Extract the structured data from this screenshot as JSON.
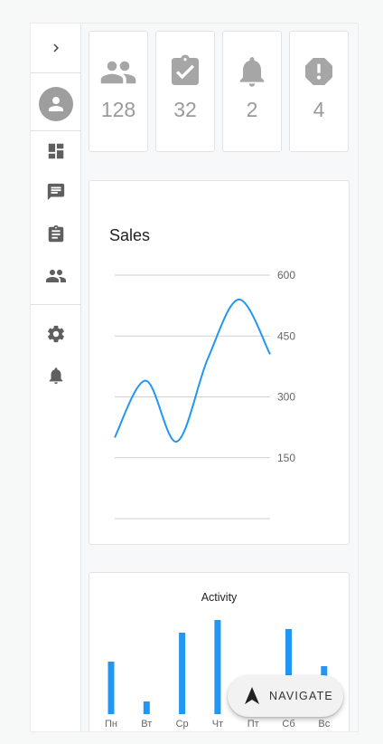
{
  "sidebar": {
    "expand_icon": "chevron-right-icon",
    "items": [
      {
        "name": "dashboard",
        "icon": "dashboard-icon"
      },
      {
        "name": "messages",
        "icon": "message-icon"
      },
      {
        "name": "tasks",
        "icon": "clipboard-icon"
      },
      {
        "name": "users",
        "icon": "people-icon"
      },
      {
        "name": "settings",
        "icon": "gear-icon"
      },
      {
        "name": "notifications",
        "icon": "bell-icon"
      }
    ]
  },
  "stats": [
    {
      "icon": "people-icon",
      "value": "128"
    },
    {
      "icon": "task-done-icon",
      "value": "32"
    },
    {
      "icon": "bell-icon",
      "value": "2"
    },
    {
      "icon": "alert-icon",
      "value": "4"
    }
  ],
  "sales": {
    "title": "Sales"
  },
  "activity": {
    "title": "Activity"
  },
  "fab": {
    "label": "NAVIGATE",
    "icon": "navigation-arrow-icon"
  },
  "colors": {
    "accent": "#2196f3",
    "icon_grey": "#a6a6a6",
    "sidebar_icon": "#5f5f5f"
  },
  "chart_data": [
    {
      "type": "line",
      "title": "Sales",
      "x": [
        1,
        2,
        3,
        4,
        5,
        6
      ],
      "y_ticks": [
        150,
        300,
        450,
        600
      ],
      "ylim": [
        0,
        600
      ],
      "values": [
        200,
        340,
        190,
        395,
        540,
        405
      ],
      "grid": true,
      "y_axis_side": "right",
      "series": [
        {
          "values": [
            200,
            340,
            190,
            395,
            540,
            405
          ]
        }
      ]
    },
    {
      "type": "bar",
      "title": "Activity",
      "categories": [
        "Пн",
        "Вт",
        "Ср",
        "Чт",
        "Пт",
        "Сб",
        "Вс"
      ],
      "values": [
        58,
        14,
        90,
        104,
        0,
        94,
        53
      ],
      "grid": false
    }
  ]
}
